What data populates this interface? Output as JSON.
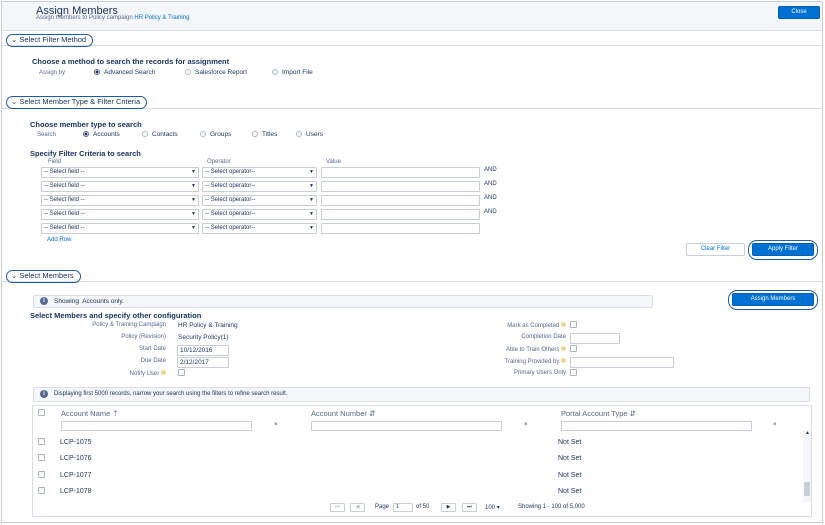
{
  "header": {
    "title": "Assign Members",
    "subtitle_prefix": "Assign members to Policy campaign",
    "subtitle_link": "HR Policy & Training",
    "close_label": "Close"
  },
  "filter_method": {
    "section_title": "Select Filter Method",
    "heading": "Choose a method to search the records for assignment",
    "assign_by_label": "Assign by",
    "options": [
      "Advanced Search",
      "Salesforce Report",
      "Import File"
    ],
    "selected": "Advanced Search"
  },
  "member_type": {
    "section_title": "Select Member Type & Filter Criteria",
    "heading": "Choose member type to search",
    "search_label": "Search",
    "options": [
      "Accounts",
      "Contacts",
      "Groups",
      "Titles",
      "Users"
    ],
    "selected": "Accounts",
    "criteria_heading": "Specify Filter Criteria to search",
    "col_field": "Field",
    "col_operator": "Operator",
    "col_value": "Value",
    "field_placeholder": "-- Select field --",
    "operator_placeholder": "-- Select operator--",
    "and_label": "AND",
    "add_row": "Add Row",
    "clear_filter": "Clear Filter",
    "apply_filter": "Apply Filter"
  },
  "members": {
    "section_title": "Select Members",
    "showing_label": "Showing",
    "showing_value": "Accounts only.",
    "assign_button": "Assign Members",
    "config_heading": "Select Members and specify other configuration",
    "campaign_label": "Policy & Training Campaign",
    "campaign_value": "HR Policy & Training",
    "policy_label": "Policy (Revision)",
    "policy_value": "Security Policy(1)",
    "start_label": "Start Date",
    "start_value": "10/12/2016",
    "due_label": "Due Date",
    "due_value": "2/12/2017",
    "notify_label": "Notify User",
    "mark_completed_label": "Mark as Completed",
    "completion_date_label": "Completion Date",
    "able_to_train_label": "Able to Train Others",
    "training_provided_label": "Training Provided by",
    "primary_users_label": "Primary Users Only",
    "info_text": "Displaying first 5000 records, narrow your search using the filters to refine search result."
  },
  "grid": {
    "columns": [
      "Account Name",
      "Account Number",
      "Portal Account Type"
    ],
    "sort_icon": "sort-arrows-icon",
    "clear_glyph": "×",
    "rows": [
      {
        "name": "LCP-1075",
        "number": "",
        "type": "Not Set"
      },
      {
        "name": "LCP-1076",
        "number": "",
        "type": "Not Set"
      },
      {
        "name": "LCP-1077",
        "number": "",
        "type": "Not Set"
      },
      {
        "name": "LCP-1078",
        "number": "",
        "type": "Not Set"
      }
    ]
  },
  "pager": {
    "first_icon": "first-page-icon",
    "prev_icon": "prev-page-icon",
    "next_icon": "next-page-icon",
    "last_icon": "last-page-icon",
    "page_label": "Page",
    "page_value": "1",
    "of_label": "of 50",
    "page_size": "100",
    "summary": "Showing 1 - 100 of 5,000"
  },
  "colors": {
    "brand": "#0070d2",
    "text": "#16325c",
    "muted": "#54698d",
    "highlight_ring": "#1f5ca8"
  }
}
